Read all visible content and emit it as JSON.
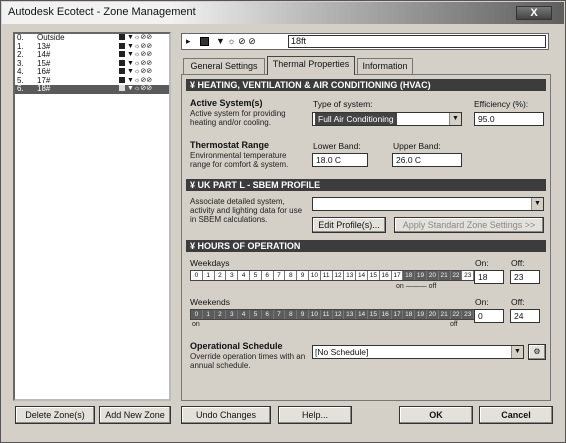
{
  "window": {
    "title": "Autodesk Ecotect - Zone Management",
    "close_label": "X"
  },
  "zones": [
    {
      "num": "0.",
      "name": "Outside",
      "selected": false
    },
    {
      "num": "1.",
      "name": "13#",
      "selected": false
    },
    {
      "num": "2.",
      "name": "14#",
      "selected": false
    },
    {
      "num": "3.",
      "name": "15#",
      "selected": false
    },
    {
      "num": "4.",
      "name": "16#",
      "selected": false
    },
    {
      "num": "5.",
      "name": "17#",
      "selected": false
    },
    {
      "num": "6.",
      "name": "18#",
      "selected": true
    }
  ],
  "zone_icons": "▼☼⊘⊘",
  "header": {
    "arrow": "▸",
    "icons": "▼ ☼ ⊘ ⊘",
    "zone_name": "18ft"
  },
  "tabs": [
    {
      "label": "General Settings",
      "active": false
    },
    {
      "label": "Thermal Properties",
      "active": true
    },
    {
      "label": "Information",
      "active": false
    }
  ],
  "hvac": {
    "header": "¥ HEATING, VENTILATION & AIR CONDITIONING (HVAC)",
    "active_title": "Active System(s)",
    "active_desc": "Active system for providing heating and/or cooling.",
    "type_label": "Type of system:",
    "type_value": "Full Air Conditioning",
    "efficiency_label": "Efficiency (%):",
    "efficiency_value": "95.0",
    "thermostat_title": "Thermostat Range",
    "thermostat_desc": "Environmental temperature range for comfort & system.",
    "lower_label": "Lower Band:",
    "lower_value": "18.0 C",
    "upper_label": "Upper Band:",
    "upper_value": "26.0 C"
  },
  "sbem": {
    "header": "¥ UK PART L - SBEM PROFILE",
    "desc": "Associate detailed system, activity and lighting data for use in SBEM calculations.",
    "profile_value": "",
    "edit_button": "Edit Profile(s)...",
    "apply_button": "Apply Standard Zone Settings >>"
  },
  "hours": {
    "header": "¥ HOURS OF OPERATION",
    "weekdays_label": "Weekdays",
    "weekend_label": "Weekends",
    "on_label": "On:",
    "off_label": "Off:",
    "weekday_on": "18",
    "weekday_off": "23",
    "weekend_on": "0",
    "weekend_off": "24",
    "weekday_band": "on ——— off",
    "weekend_band_on": "on",
    "weekend_band_off": "off",
    "hour_labels": [
      "0",
      "1",
      "2",
      "3",
      "4",
      "5",
      "6",
      "7",
      "8",
      "9",
      "10",
      "11",
      "12",
      "13",
      "14",
      "15",
      "16",
      "17",
      "18",
      "19",
      "20",
      "21",
      "22",
      "23"
    ],
    "weekday_active": [
      18,
      23
    ],
    "weekend_active": [
      0,
      24
    ]
  },
  "schedule": {
    "title": "Operational Schedule",
    "desc": "Override operation times with an annual schedule.",
    "value": "[No Schedule]"
  },
  "buttons": {
    "delete_zone": "Delete Zone(s)",
    "add_zone": "Add New Zone",
    "undo": "Undo Changes",
    "help": "Help...",
    "ok": "OK",
    "cancel": "Cancel"
  }
}
